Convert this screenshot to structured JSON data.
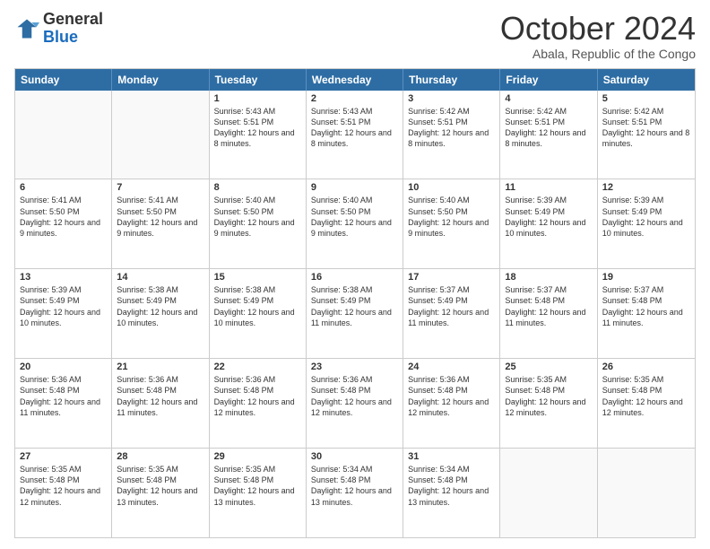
{
  "logo": {
    "general": "General",
    "blue": "Blue"
  },
  "header": {
    "title": "October 2024",
    "subtitle": "Abala, Republic of the Congo"
  },
  "days_of_week": [
    "Sunday",
    "Monday",
    "Tuesday",
    "Wednesday",
    "Thursday",
    "Friday",
    "Saturday"
  ],
  "weeks": [
    [
      {
        "num": "",
        "empty": true
      },
      {
        "num": "",
        "empty": true
      },
      {
        "num": "1",
        "sunrise": "Sunrise: 5:43 AM",
        "sunset": "Sunset: 5:51 PM",
        "daylight": "Daylight: 12 hours and 8 minutes."
      },
      {
        "num": "2",
        "sunrise": "Sunrise: 5:43 AM",
        "sunset": "Sunset: 5:51 PM",
        "daylight": "Daylight: 12 hours and 8 minutes."
      },
      {
        "num": "3",
        "sunrise": "Sunrise: 5:42 AM",
        "sunset": "Sunset: 5:51 PM",
        "daylight": "Daylight: 12 hours and 8 minutes."
      },
      {
        "num": "4",
        "sunrise": "Sunrise: 5:42 AM",
        "sunset": "Sunset: 5:51 PM",
        "daylight": "Daylight: 12 hours and 8 minutes."
      },
      {
        "num": "5",
        "sunrise": "Sunrise: 5:42 AM",
        "sunset": "Sunset: 5:51 PM",
        "daylight": "Daylight: 12 hours and 8 minutes."
      }
    ],
    [
      {
        "num": "6",
        "sunrise": "Sunrise: 5:41 AM",
        "sunset": "Sunset: 5:50 PM",
        "daylight": "Daylight: 12 hours and 9 minutes."
      },
      {
        "num": "7",
        "sunrise": "Sunrise: 5:41 AM",
        "sunset": "Sunset: 5:50 PM",
        "daylight": "Daylight: 12 hours and 9 minutes."
      },
      {
        "num": "8",
        "sunrise": "Sunrise: 5:40 AM",
        "sunset": "Sunset: 5:50 PM",
        "daylight": "Daylight: 12 hours and 9 minutes."
      },
      {
        "num": "9",
        "sunrise": "Sunrise: 5:40 AM",
        "sunset": "Sunset: 5:50 PM",
        "daylight": "Daylight: 12 hours and 9 minutes."
      },
      {
        "num": "10",
        "sunrise": "Sunrise: 5:40 AM",
        "sunset": "Sunset: 5:50 PM",
        "daylight": "Daylight: 12 hours and 9 minutes."
      },
      {
        "num": "11",
        "sunrise": "Sunrise: 5:39 AM",
        "sunset": "Sunset: 5:49 PM",
        "daylight": "Daylight: 12 hours and 10 minutes."
      },
      {
        "num": "12",
        "sunrise": "Sunrise: 5:39 AM",
        "sunset": "Sunset: 5:49 PM",
        "daylight": "Daylight: 12 hours and 10 minutes."
      }
    ],
    [
      {
        "num": "13",
        "sunrise": "Sunrise: 5:39 AM",
        "sunset": "Sunset: 5:49 PM",
        "daylight": "Daylight: 12 hours and 10 minutes."
      },
      {
        "num": "14",
        "sunrise": "Sunrise: 5:38 AM",
        "sunset": "Sunset: 5:49 PM",
        "daylight": "Daylight: 12 hours and 10 minutes."
      },
      {
        "num": "15",
        "sunrise": "Sunrise: 5:38 AM",
        "sunset": "Sunset: 5:49 PM",
        "daylight": "Daylight: 12 hours and 10 minutes."
      },
      {
        "num": "16",
        "sunrise": "Sunrise: 5:38 AM",
        "sunset": "Sunset: 5:49 PM",
        "daylight": "Daylight: 12 hours and 11 minutes."
      },
      {
        "num": "17",
        "sunrise": "Sunrise: 5:37 AM",
        "sunset": "Sunset: 5:49 PM",
        "daylight": "Daylight: 12 hours and 11 minutes."
      },
      {
        "num": "18",
        "sunrise": "Sunrise: 5:37 AM",
        "sunset": "Sunset: 5:48 PM",
        "daylight": "Daylight: 12 hours and 11 minutes."
      },
      {
        "num": "19",
        "sunrise": "Sunrise: 5:37 AM",
        "sunset": "Sunset: 5:48 PM",
        "daylight": "Daylight: 12 hours and 11 minutes."
      }
    ],
    [
      {
        "num": "20",
        "sunrise": "Sunrise: 5:36 AM",
        "sunset": "Sunset: 5:48 PM",
        "daylight": "Daylight: 12 hours and 11 minutes."
      },
      {
        "num": "21",
        "sunrise": "Sunrise: 5:36 AM",
        "sunset": "Sunset: 5:48 PM",
        "daylight": "Daylight: 12 hours and 11 minutes."
      },
      {
        "num": "22",
        "sunrise": "Sunrise: 5:36 AM",
        "sunset": "Sunset: 5:48 PM",
        "daylight": "Daylight: 12 hours and 12 minutes."
      },
      {
        "num": "23",
        "sunrise": "Sunrise: 5:36 AM",
        "sunset": "Sunset: 5:48 PM",
        "daylight": "Daylight: 12 hours and 12 minutes."
      },
      {
        "num": "24",
        "sunrise": "Sunrise: 5:36 AM",
        "sunset": "Sunset: 5:48 PM",
        "daylight": "Daylight: 12 hours and 12 minutes."
      },
      {
        "num": "25",
        "sunrise": "Sunrise: 5:35 AM",
        "sunset": "Sunset: 5:48 PM",
        "daylight": "Daylight: 12 hours and 12 minutes."
      },
      {
        "num": "26",
        "sunrise": "Sunrise: 5:35 AM",
        "sunset": "Sunset: 5:48 PM",
        "daylight": "Daylight: 12 hours and 12 minutes."
      }
    ],
    [
      {
        "num": "27",
        "sunrise": "Sunrise: 5:35 AM",
        "sunset": "Sunset: 5:48 PM",
        "daylight": "Daylight: 12 hours and 12 minutes."
      },
      {
        "num": "28",
        "sunrise": "Sunrise: 5:35 AM",
        "sunset": "Sunset: 5:48 PM",
        "daylight": "Daylight: 12 hours and 13 minutes."
      },
      {
        "num": "29",
        "sunrise": "Sunrise: 5:35 AM",
        "sunset": "Sunset: 5:48 PM",
        "daylight": "Daylight: 12 hours and 13 minutes."
      },
      {
        "num": "30",
        "sunrise": "Sunrise: 5:34 AM",
        "sunset": "Sunset: 5:48 PM",
        "daylight": "Daylight: 12 hours and 13 minutes."
      },
      {
        "num": "31",
        "sunrise": "Sunrise: 5:34 AM",
        "sunset": "Sunset: 5:48 PM",
        "daylight": "Daylight: 12 hours and 13 minutes."
      },
      {
        "num": "",
        "empty": true
      },
      {
        "num": "",
        "empty": true
      }
    ]
  ]
}
